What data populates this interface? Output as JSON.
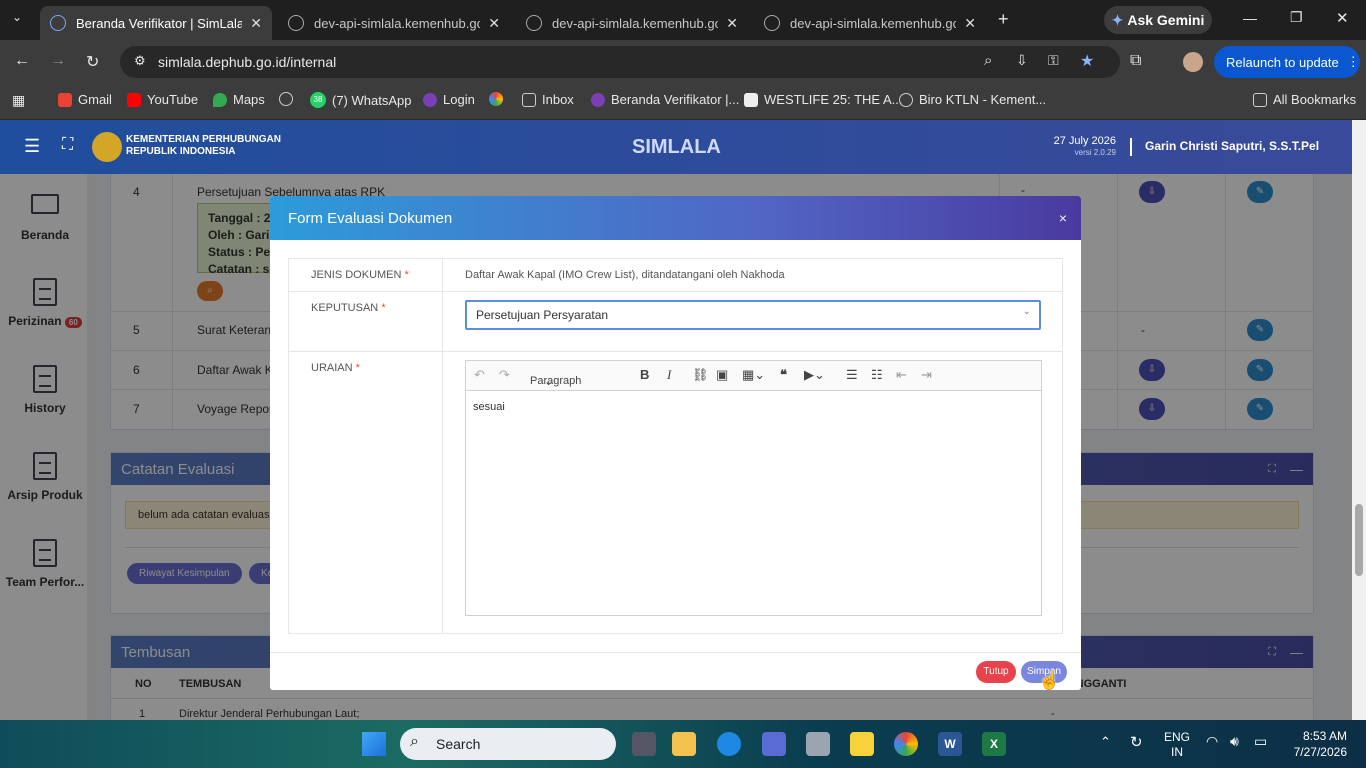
{
  "browser": {
    "tabs": [
      {
        "title": "Beranda Verifikator | SimLala",
        "active": true
      },
      {
        "title": "dev-api-simlala.kemenhub.go.id",
        "active": false
      },
      {
        "title": "dev-api-simlala.kemenhub.go.id",
        "active": false
      },
      {
        "title": "dev-api-simlala.kemenhub.go.id",
        "active": false
      }
    ],
    "new_tab": "+",
    "ask_gemini": "Ask Gemini",
    "url": "simlala.dephub.go.id/internal",
    "relaunch": "Relaunch to update",
    "bookmarks": [
      "Gmail",
      "YouTube",
      "Maps",
      "(7) WhatsApp",
      "Login",
      "Inbox",
      "Beranda Verifikator |...",
      "WESTLIFE 25: THE A...",
      "Biro KTLN - Kement..."
    ],
    "whatsapp_badge": "38",
    "all_bookmarks": "All Bookmarks"
  },
  "app": {
    "org_line1": "KEMENTERIAN PERHUBUNGAN",
    "org_line2": "REPUBLIK INDONESIA",
    "title": "SIMLALA",
    "date": "27 July 2026",
    "version": "versi 2.0.29",
    "user": "Garin Christi Saputri, S.S.T.Pel"
  },
  "sidebar": {
    "items": [
      {
        "label": "Beranda"
      },
      {
        "label": "Perizinan",
        "badge": "60"
      },
      {
        "label": "History"
      },
      {
        "label": "Arsip Produk"
      },
      {
        "label": "Team Perfor..."
      }
    ]
  },
  "table": {
    "rows": [
      {
        "no": "4",
        "name": "Persetujuan Sebelumnya atas RPK",
        "dash": "-"
      },
      {
        "no": "5",
        "name": "Surat Keterangan",
        "dash": "-"
      },
      {
        "no": "6",
        "name": "Daftar Awak Kap"
      },
      {
        "no": "7",
        "name": "Voyage Report ("
      }
    ],
    "detail": {
      "tanggal": "Tanggal : 27",
      "oleh": "Oleh : Garin",
      "status": "Status : Pers",
      "catatan": "Catatan : ses"
    }
  },
  "catatan": {
    "title": "Catatan Evaluasi",
    "empty": "belum ada catatan evaluasi",
    "btn_riwayat": "Riwayat Kesimpulan",
    "btn_kesim": "Kesim"
  },
  "tembusan": {
    "title": "Tembusan",
    "col_no": "NO",
    "col_tembusan": "TEMBUSAN",
    "col_pengganti": "PENGGANTI",
    "row_no": "1",
    "row_text": "Direktur Jenderal Perhubungan Laut;",
    "row_dash": "-"
  },
  "modal": {
    "title": "Form Evaluasi Dokumen",
    "close": "×",
    "label_jenis": "JENIS DOKUMEN",
    "value_jenis": "Daftar Awak Kapal (IMO Crew List), ditandatangani oleh Nakhoda",
    "label_keputusan": "KEPUTUSAN",
    "value_keputusan": "Persetujuan Persyaratan",
    "label_uraian": "URAIAN",
    "paragraph": "Paragraph",
    "uraian_text": "sesuai",
    "btn_tutup": "Tutup",
    "btn_simpan": "Simpan",
    "required_mark": "*"
  },
  "taskbar": {
    "search": "Search",
    "lang1": "ENG",
    "lang2": "IN",
    "time": "8:53 AM",
    "date": "7/27/2026"
  }
}
